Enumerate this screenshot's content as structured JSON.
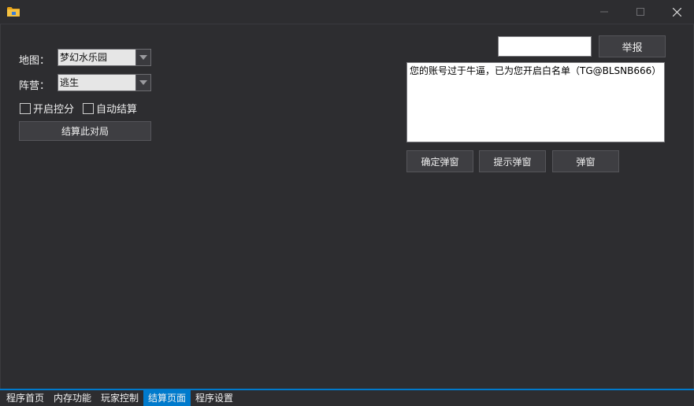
{
  "window": {
    "icon": "folder-icon",
    "controls": {
      "minimize": "minimize-icon",
      "maximize": "maximize-icon",
      "close": "close-icon"
    }
  },
  "left_panel": {
    "map_label": "地图：",
    "map_value": "梦幻水乐园",
    "camp_label": "阵营：",
    "camp_value": "逃生",
    "checkbox_control": {
      "label": "开启控分",
      "checked": false
    },
    "checkbox_autosettle": {
      "label": "自动结算",
      "checked": false
    },
    "settle_button": "结算此对局"
  },
  "right_panel": {
    "report_input_value": "",
    "report_button": "举报",
    "message_text": "您的账号过于牛逼，已为您开启白名单（TG@BLSNB666）",
    "confirm_popup_button": "确定弹窗",
    "hint_popup_button": "提示弹窗",
    "popup_button": "弹窗"
  },
  "tabs": [
    {
      "label": "程序首页",
      "active": false
    },
    {
      "label": "内存功能",
      "active": false
    },
    {
      "label": "玩家控制",
      "active": false
    },
    {
      "label": "结算页面",
      "active": true
    },
    {
      "label": "程序设置",
      "active": false
    }
  ],
  "colors": {
    "background": "#2d2d30",
    "accent": "#007acc",
    "button": "#3e3e42"
  }
}
